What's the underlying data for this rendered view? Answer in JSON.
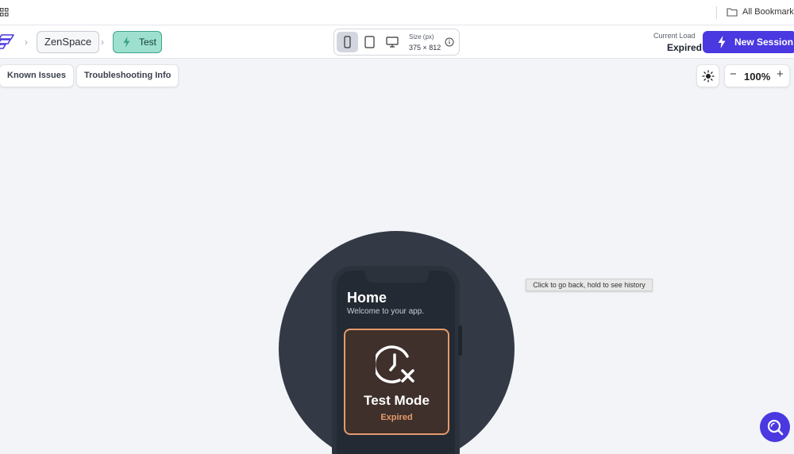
{
  "bookmarks_bar": {
    "apps_icon": "apps-grid-icon",
    "folder_icon": "folder-icon",
    "all_bookmarks_label": "All Bookmarks"
  },
  "toolbar": {
    "logo_icon": "app-logo-icon",
    "breadcrumb": [
      "ZenSpace",
      "Test"
    ],
    "device_modes": [
      "phone",
      "tablet",
      "desktop"
    ],
    "active_device": "phone",
    "size_label": "Size (px)",
    "size_value": "375 × 812",
    "current_load_label": "Current Load",
    "current_load_value": "Expired",
    "new_session_label": "New Session"
  },
  "actions": {
    "known_issues_label": "Known Issues",
    "troubleshooting_label": "Troubleshooting Info",
    "theme_icon": "sun-icon",
    "zoom_minus": "−",
    "zoom_value": "100%",
    "zoom_plus": "+"
  },
  "preview": {
    "home_title": "Home",
    "home_subtitle": "Welcome to your app.",
    "card_title": "Test Mode",
    "card_status": "Expired"
  },
  "tooltip": "Click to go back, hold to see history",
  "colors": {
    "accent": "#4a38e0",
    "test_badge_bg": "#9ee0cf",
    "card_border": "#e49a6c",
    "stage_circle": "#333a46"
  }
}
